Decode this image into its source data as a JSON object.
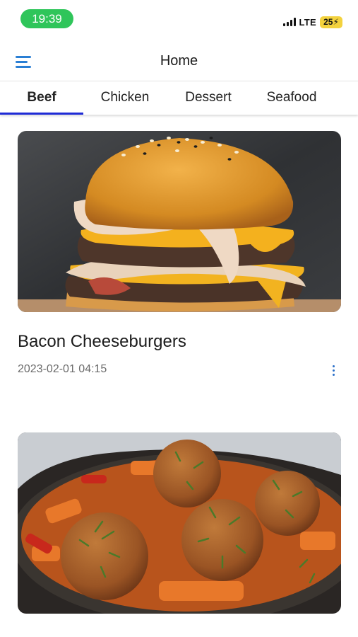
{
  "status_bar": {
    "time": "19:39",
    "network": "LTE",
    "battery": "25"
  },
  "app_bar": {
    "title": "Home"
  },
  "tabs": [
    {
      "label": "Beef",
      "active": true
    },
    {
      "label": "Chicken",
      "active": false
    },
    {
      "label": "Dessert",
      "active": false
    },
    {
      "label": "Seafood",
      "active": false
    }
  ],
  "recipes": [
    {
      "title": "Bacon Cheeseburgers",
      "date": "2023-02-01 04:15"
    }
  ],
  "colors": {
    "accent": "#2a7fd4",
    "tab_indicator": "#1f2bd6",
    "time_pill": "#2fc55a",
    "battery": "#f3d23e"
  }
}
